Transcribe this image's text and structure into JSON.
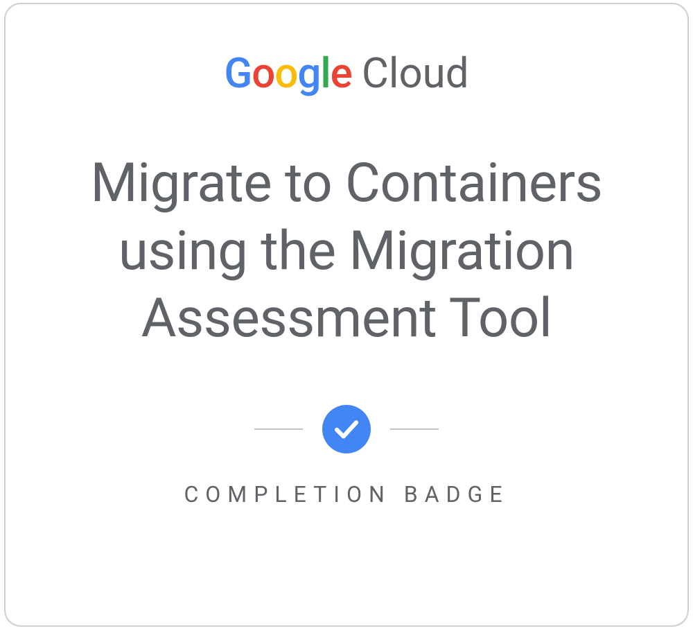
{
  "logo": {
    "google": {
      "g1": "G",
      "o1": "o",
      "o2": "o",
      "g2": "g",
      "l": "l",
      "e": "e"
    },
    "cloud": "Cloud"
  },
  "course_title": "Migrate to Containers using the Migration Assessment Tool",
  "completion_label": "COMPLETION BADGE",
  "colors": {
    "blue": "#4285F4",
    "red": "#EA4335",
    "yellow": "#FBBC05",
    "green": "#34A853",
    "text_gray": "#5f6368"
  }
}
